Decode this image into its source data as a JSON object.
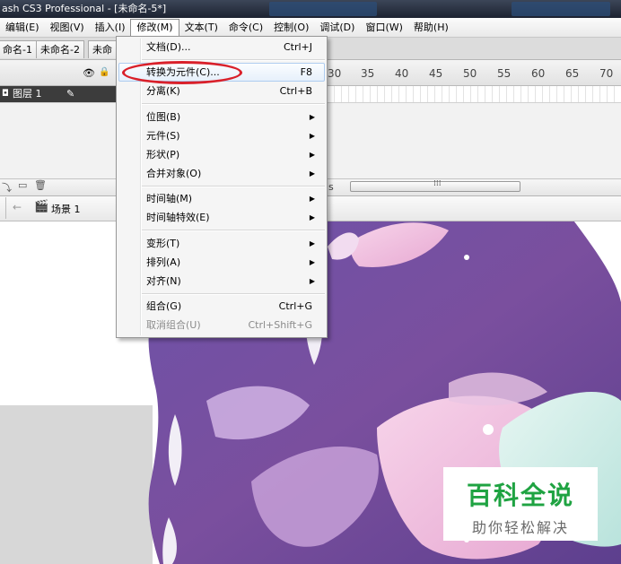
{
  "window": {
    "title": "ash CS3 Professional - [未命名-5*]"
  },
  "menubar": {
    "items": [
      {
        "label": "编辑(E)"
      },
      {
        "label": "视图(V)"
      },
      {
        "label": "插入(I)"
      },
      {
        "label": "修改(M)",
        "active": true
      },
      {
        "label": "文本(T)"
      },
      {
        "label": "命令(C)"
      },
      {
        "label": "控制(O)"
      },
      {
        "label": "调试(D)"
      },
      {
        "label": "窗口(W)"
      },
      {
        "label": "帮助(H)"
      }
    ]
  },
  "doc_tabs": [
    "命名-1",
    "未命名-2",
    "未命名"
  ],
  "timeline": {
    "ruler": [
      "30",
      "35",
      "40",
      "45",
      "50",
      "55",
      "60",
      "65",
      "70"
    ],
    "layer_name": "图层 1",
    "fps_suffix": "s"
  },
  "breadcrumb": {
    "scene": "场景 1"
  },
  "modify_menu": {
    "items": [
      {
        "label": "文档(D)...",
        "shortcut": "Ctrl+J"
      },
      {
        "label": "转换为元件(C)...",
        "shortcut": "F8",
        "highlighted": true
      },
      {
        "label": "分离(K)",
        "shortcut": "Ctrl+B"
      },
      {
        "label": "位图(B)",
        "submenu": true
      },
      {
        "label": "元件(S)",
        "submenu": true
      },
      {
        "label": "形状(P)",
        "submenu": true
      },
      {
        "label": "合并对象(O)",
        "submenu": true
      },
      {
        "label": "时间轴(M)",
        "submenu": true
      },
      {
        "label": "时间轴特效(E)",
        "submenu": true
      },
      {
        "label": "变形(T)",
        "submenu": true
      },
      {
        "label": "排列(A)",
        "submenu": true
      },
      {
        "label": "对齐(N)",
        "submenu": true
      },
      {
        "label": "组合(G)",
        "shortcut": "Ctrl+G"
      },
      {
        "label": "取消组合(U)",
        "shortcut": "Ctrl+Shift+G",
        "disabled": true
      }
    ]
  },
  "watermark": {
    "line1": "百科全说",
    "line2": "助你轻松解决"
  },
  "colors": {
    "annotation": "#d9202a",
    "watermark": "#1fa342",
    "artwork_purple": "#6a4c9c"
  }
}
